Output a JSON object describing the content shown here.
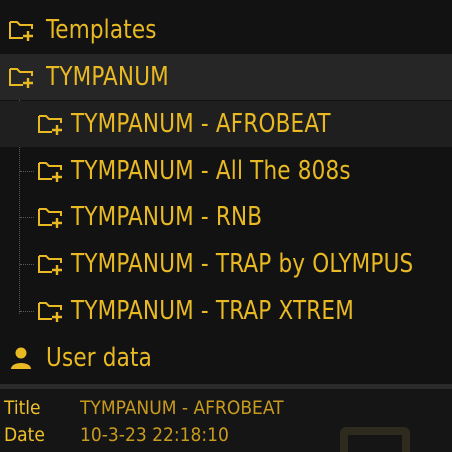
{
  "tree": {
    "items": [
      {
        "label": "Templates",
        "icon": "folder-plus-icon"
      },
      {
        "label": "TYMPANUM",
        "icon": "folder-plus-icon"
      },
      {
        "label": "TYMPANUM - AFROBEAT",
        "icon": "folder-plus-icon"
      },
      {
        "label": "TYMPANUM - All The 808s",
        "icon": "folder-plus-icon"
      },
      {
        "label": "TYMPANUM - RNB",
        "icon": "folder-plus-icon"
      },
      {
        "label": "TYMPANUM - TRAP by OLYMPUS",
        "icon": "folder-plus-icon"
      },
      {
        "label": "TYMPANUM - TRAP XTREM",
        "icon": "folder-plus-icon"
      },
      {
        "label": "User data",
        "icon": "user-icon"
      }
    ]
  },
  "info": {
    "title_key": "Title",
    "title_value": "TYMPANUM - AFROBEAT",
    "date_key": "Date",
    "date_value": "10-3-23 22:18:10"
  },
  "colors": {
    "accent": "#e8b923",
    "background": "#121212",
    "selected_row": "#262626"
  }
}
